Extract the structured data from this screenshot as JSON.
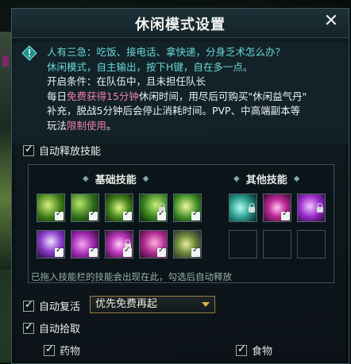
{
  "title": "休闲模式设置",
  "notice": {
    "line1": "人有三急：吃饭、接电话、拿快递，分身乏术怎么办？",
    "line2": "休闲模式，自主输出，按下H键，自在多一点。",
    "line3": "开启条件：在队伍中，且未担任队长",
    "line4_pre": "每日",
    "line4_hl": "免费获得15分钟",
    "line4_post": "休闲时间，用尽后可购买\"休闲益气丹\"",
    "line5": "补充，脱战5分钟后会停止消耗时间。PVP、中高端副本等",
    "line6_pre": "玩法",
    "line6_hl": "限制使用",
    "line6_post": "。"
  },
  "auto_skill_label": "自动释放技能",
  "basic_skills_title": "基础技能",
  "other_skills_title": "其他技能",
  "hint": "已拖入技能栏的技能会出现在此，勾选后自动释放",
  "auto_revive_label": "自动复活",
  "revive_option": "优先免费再起",
  "auto_pickup_label": "自动拾取",
  "pickup_medicine_label": "药物",
  "pickup_food_label": "食物",
  "colors": {
    "accent_cyan": "#6ad8d6",
    "highlight_pink": "#f07fb0",
    "dropdown_border": "#9c7a3c"
  }
}
